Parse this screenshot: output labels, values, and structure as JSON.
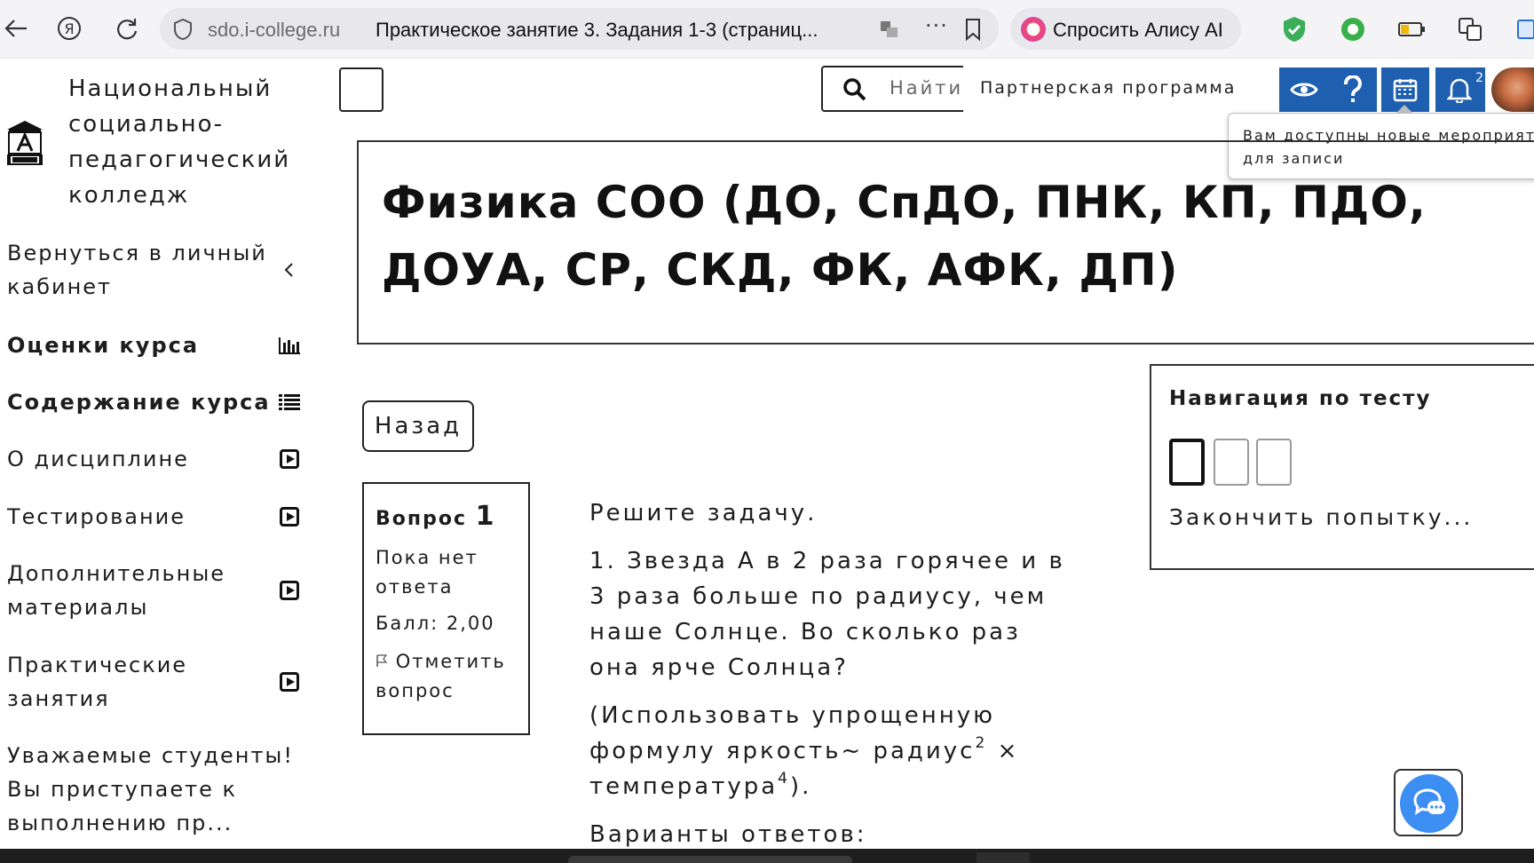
{
  "browser": {
    "domain": "sdo.i-college.ru",
    "tab_title": "Практическое занятие 3. Задания 1-3 (страниц...",
    "more": "···",
    "alice_label": "Спросить Алису AI"
  },
  "sidebar": {
    "college_name": "Национальный социально-педагогический колледж",
    "items": [
      {
        "label": "Вернуться в личный кабинет",
        "icon": "chevron-left-icon"
      },
      {
        "label": "Оценки курса",
        "icon": "bar-chart-icon"
      },
      {
        "label": "Содержание курса",
        "icon": "list-icon"
      },
      {
        "label": "О дисциплине",
        "icon": "play-icon"
      },
      {
        "label": "Тестирование",
        "icon": "play-icon"
      },
      {
        "label": "Дополнительные материалы",
        "icon": "play-icon"
      },
      {
        "label": "Практические занятия",
        "icon": "play-icon"
      },
      {
        "label": "Уважаемые студенты! Вы приступаете к выполнению пр..."
      }
    ]
  },
  "topbar": {
    "search_placeholder": "Найти",
    "partner_link": "Партнерская программа",
    "notifications_count": "2",
    "tooltip_line1": "Вам доступны новые мероприят",
    "tooltip_line2": "для записи"
  },
  "course": {
    "title": "Физика СОО (ДО, СпДО, ПНК, КП, ПДО, ДОУА, СР, СКД, ФК, АФК, ДП)"
  },
  "main": {
    "back_label": "Назад",
    "question": {
      "label": "Вопрос",
      "number": "1",
      "status": "Пока нет ответа",
      "score": "Балл: 2,00",
      "flag_label": "Отметить вопрос"
    },
    "text": {
      "intro": "Решите задачу.",
      "problem": "1. Звезда А в 2 раза горячее и в 3 раза больше по радиусу, чем наше Солнце. Во сколько раз она ярче Солнца?",
      "hint_part1": "(Использовать упрощенную формулу яркость~ радиус",
      "hint_sup1": "2",
      "hint_part2": " × температура",
      "hint_sup2": "4",
      "hint_part3": ").",
      "variants": "Варианты ответов:"
    }
  },
  "nav": {
    "title": "Навигация по тесту",
    "finish": "Закончить попытку..."
  },
  "colors": {
    "accent_blue": "#1f5fb0",
    "chat_blue": "#3d8ef2"
  }
}
